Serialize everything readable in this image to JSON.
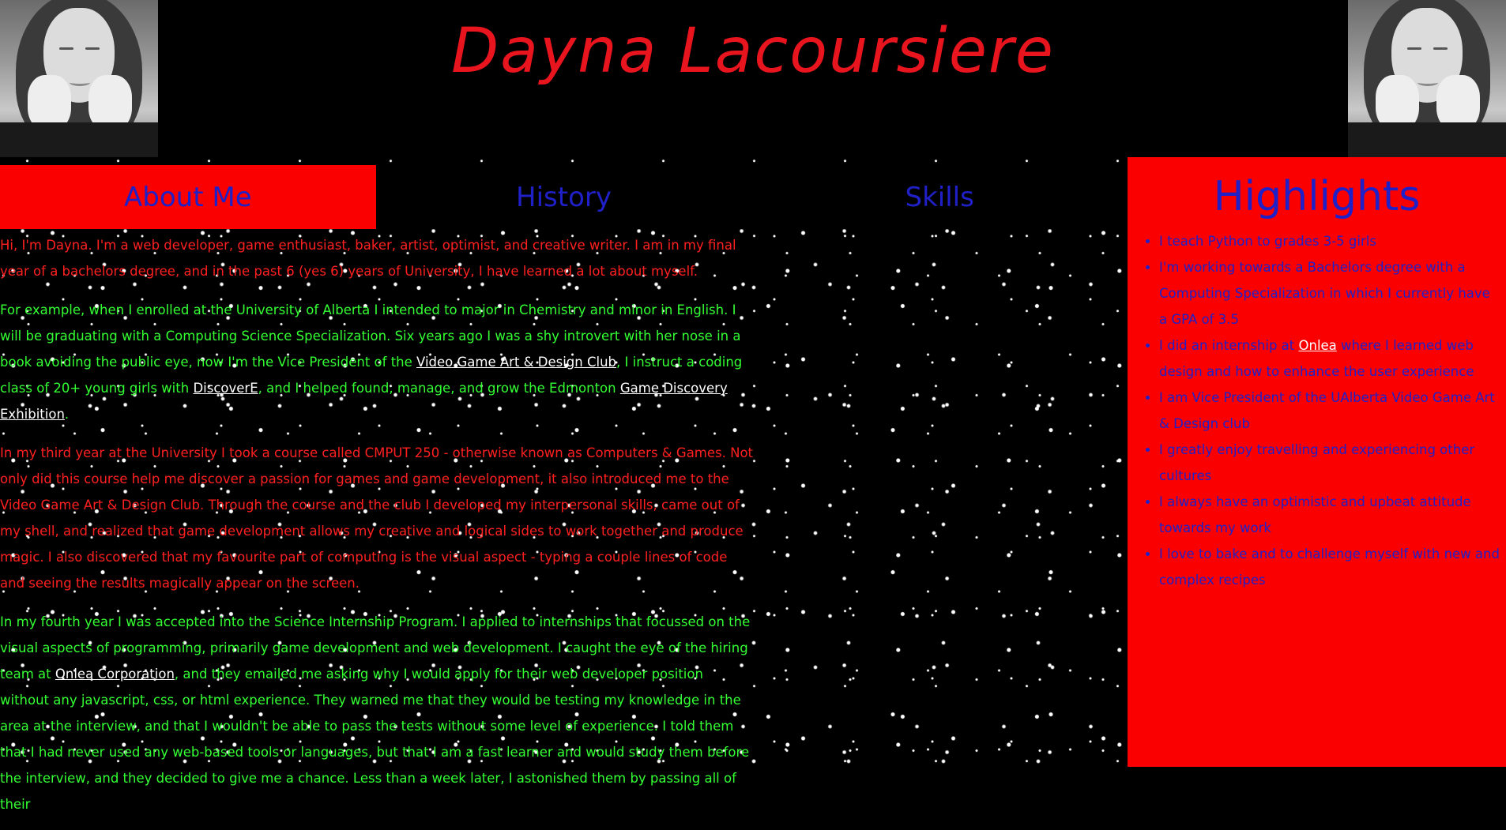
{
  "header": {
    "title": "Dayna Lacoursiere"
  },
  "nav": {
    "tabs": [
      {
        "label": "About Me",
        "active": true
      },
      {
        "label": "History",
        "active": false
      },
      {
        "label": "Skills",
        "active": false
      }
    ]
  },
  "about": {
    "p1": "Hi, I'm Dayna. I'm a web developer, game enthusiast, baker, artist, optimist, and creative writer. I am in my final year of a bachelors degree, and in the past 6 (yes 6) years of University, I have learned a lot about myself.",
    "p2": {
      "before_link1": "For example, when I enrolled at the University of Alberta I intended to major in Chemistry and minor in English. I will be graduating with a Computing Science Specialization. Six years ago I was a shy introvert with her nose in a book avoiding the public eye, now I'm the Vice President of the ",
      "link1": "Video Game Art & Design Club",
      "between_1_2": ", I instruct a coding class of 20+ young girls with ",
      "link2": "DiscoverE",
      "between_2_3": ", and I helped found, manage, and grow the Edmonton ",
      "link3": "Game Discovery Exhibition",
      "after_link3": "."
    },
    "p3": "In my third year at the University I took a course called CMPUT 250 - otherwise known as Computers & Games. Not only did this course help me discover a passion for games and game development, it also introduced me to the Video Game Art & Design Club. Through the course and the club I developed my interpersonal skills, came out of my shell, and realized that game development allows my creative and logical sides to work together and produce magic. I also discovered that my favourite part of computing is the visual aspect - typing a couple lines of code and seeing the results magically appear on the screen.",
    "p4": {
      "before_link": "In my fourth year I was accepted into the Science Internship Program. I applied to internships that focussed on the visual aspects of programming, primarily game development and web development. I caught the eye of the hiring team at ",
      "link": "Onlea Corporation",
      "after_link": ", and they emailed me asking why I would apply for their web developer position without any javascript, css, or html experience. They warned me that they would be testing my knowledge in the area at the interview, and that I wouldn't be able to pass the tests without some level of experience. I told them that I had never used any web-based tools or languages, but that I am a fast learner and would study them before the interview, and they decided to give me a chance. Less than a week later, I astonished them by passing all of their"
    }
  },
  "highlights": {
    "title": "Highlights",
    "items": [
      {
        "text": "I teach Python to grades 3-5 girls"
      },
      {
        "text": "I'm working towards a Bachelors degree with a Computing Specialization in which I currently have a GPA of 3.5"
      },
      {
        "before": "I did an internship at ",
        "link": "Onlea",
        "after": " where I learned web design and how to enhance the user experience"
      },
      {
        "text": "I am Vice President of the UAlberta Video Game Art & Design club"
      },
      {
        "text": "I greatly enjoy travelling and experiencing other cultures"
      },
      {
        "text": "I always have an optimistic and upbeat attitude towards my work"
      },
      {
        "text": "I love to bake and to challenge myself with new and complex recipes"
      }
    ]
  },
  "colors": {
    "accent_red": "#fa0000",
    "title_red": "#e8141e",
    "tab_blue": "#2020c8",
    "text_green": "#33ff33",
    "background": "#000000"
  },
  "icons": [
    "portrait-photo-left",
    "portrait-photo-right",
    "bullet-icon"
  ]
}
